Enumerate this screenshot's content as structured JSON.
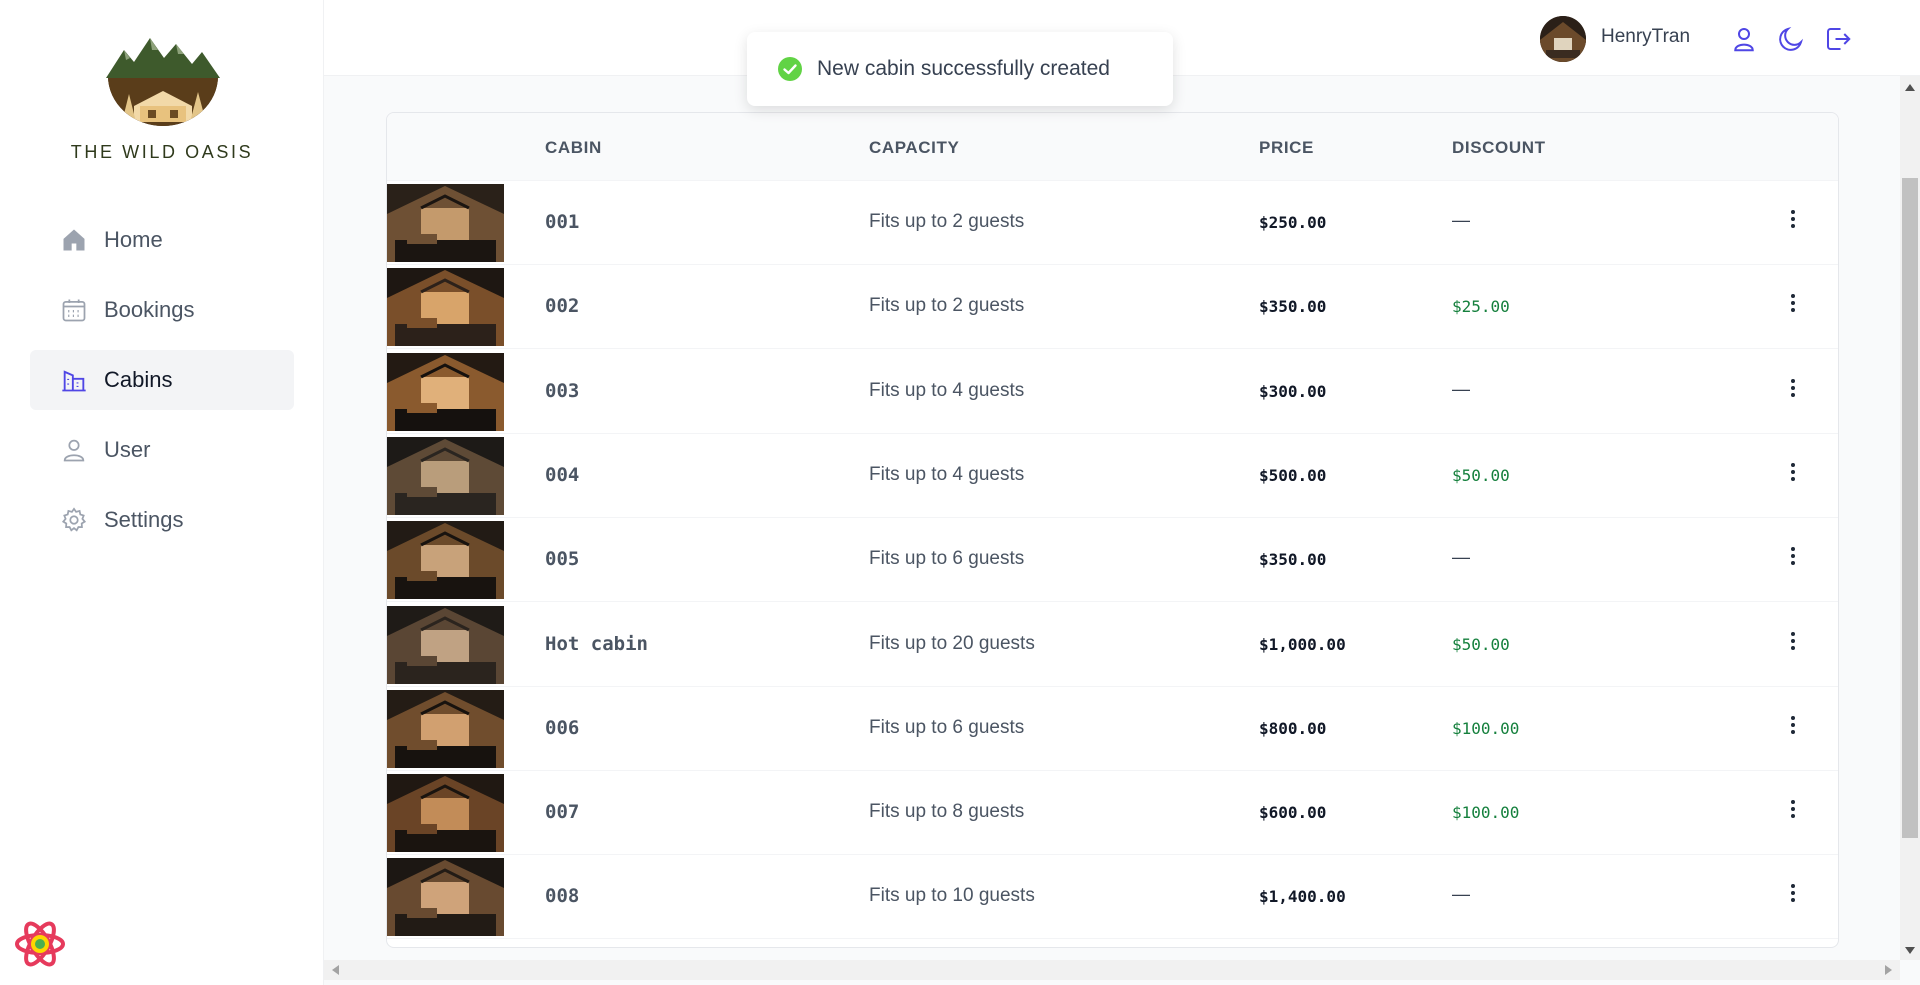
{
  "brand": {
    "name": "THE WILD OASIS"
  },
  "nav": {
    "items": [
      {
        "label": "Home",
        "icon": "home-icon",
        "active": false
      },
      {
        "label": "Bookings",
        "icon": "calendar-icon",
        "active": false
      },
      {
        "label": "Cabins",
        "icon": "buildings-icon",
        "active": true
      },
      {
        "label": "User",
        "icon": "user-icon",
        "active": false
      },
      {
        "label": "Settings",
        "icon": "gear-icon",
        "active": false
      }
    ]
  },
  "header": {
    "username": "HenryTran",
    "buttons": [
      "user-icon",
      "moon-icon",
      "logout-icon"
    ]
  },
  "toast": {
    "message": "New cabin successfully created",
    "status": "success"
  },
  "table": {
    "columns": [
      "",
      "CABIN",
      "CAPACITY",
      "PRICE",
      "DISCOUNT",
      ""
    ],
    "rows": [
      {
        "name": "001",
        "capacity": "Fits up to 2 guests",
        "price": "$250.00",
        "discount": "—"
      },
      {
        "name": "002",
        "capacity": "Fits up to 2 guests",
        "price": "$350.00",
        "discount": "$25.00"
      },
      {
        "name": "003",
        "capacity": "Fits up to 4 guests",
        "price": "$300.00",
        "discount": "—"
      },
      {
        "name": "004",
        "capacity": "Fits up to 4 guests",
        "price": "$500.00",
        "discount": "$50.00"
      },
      {
        "name": "005",
        "capacity": "Fits up to 6 guests",
        "price": "$350.00",
        "discount": "—"
      },
      {
        "name": "Hot cabin",
        "capacity": "Fits up to 20 guests",
        "price": "$1,000.00",
        "discount": "$50.00"
      },
      {
        "name": "006",
        "capacity": "Fits up to 6 guests",
        "price": "$800.00",
        "discount": "$100.00"
      },
      {
        "name": "007",
        "capacity": "Fits up to 8 guests",
        "price": "$600.00",
        "discount": "$100.00"
      },
      {
        "name": "008",
        "capacity": "Fits up to 10 guests",
        "price": "$1,400.00",
        "discount": "—"
      }
    ]
  },
  "colors": {
    "accent": "#4f46e5",
    "discount": "#15803d",
    "success": "#61d345"
  }
}
